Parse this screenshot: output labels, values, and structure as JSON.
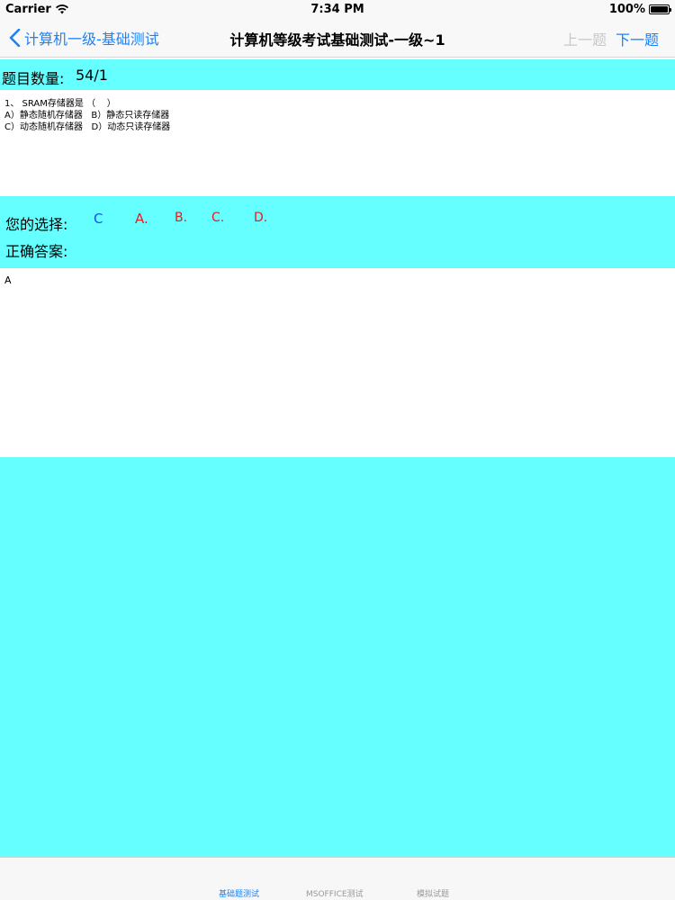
{
  "status_bar": {
    "carrier": "Carrier",
    "time": "7:34 PM",
    "battery": "100%"
  },
  "nav": {
    "back_label": "计算机一级-基础测试",
    "title": "计算机等级考试基础测试-一级~1",
    "prev_label": "上一题",
    "next_label": "下一题"
  },
  "count": {
    "label": "题目数量:",
    "value": "54/1"
  },
  "question": {
    "lines": [
      "1、 SRAM存储器是 （    ）",
      "A）静态随机存储器   B）静态只读存储器",
      "C）动态随机存储器   D）动态只读存储器"
    ]
  },
  "answer": {
    "choice_label": "您的选择:",
    "selected": "C",
    "options": [
      "A.",
      "B.",
      "C.",
      "D."
    ],
    "correct_label": "正确答案:"
  },
  "explanation": {
    "text": "A"
  },
  "tabs": [
    {
      "label": "基础题测试",
      "active": true
    },
    {
      "label": "MSOFFICE测试",
      "active": false
    },
    {
      "label": "模拟试题",
      "active": false
    }
  ],
  "colors": {
    "accent": "#1a82f7",
    "cyan": "#66ffff",
    "option_red": "#e02020"
  }
}
